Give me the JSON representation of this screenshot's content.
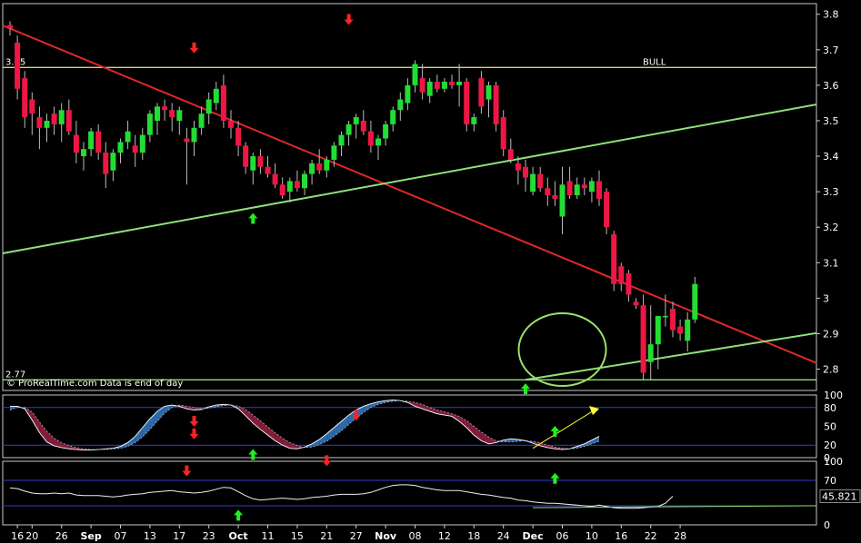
{
  "chart_data": [
    {
      "type": "candlestick",
      "watermark": "© ProRealTime.com  Data is end of day",
      "ylim": [
        2.74,
        3.83
      ],
      "yticks": [
        "3.8",
        "3.7",
        "3.6",
        "3.5",
        "3.4",
        "3.3",
        "3.2",
        "3.1",
        "3",
        "2.9",
        "2.8"
      ],
      "ytick_values": [
        3.8,
        3.7,
        3.6,
        3.5,
        3.4,
        3.3,
        3.2,
        3.1,
        3.0,
        2.9,
        2.8
      ],
      "xticks": [
        {
          "label": "16",
          "i": 1
        },
        {
          "label": "20",
          "i": 3
        },
        {
          "label": "26",
          "i": 7
        },
        {
          "label": "Sep",
          "i": 11,
          "bold": true
        },
        {
          "label": "07",
          "i": 15
        },
        {
          "label": "13",
          "i": 19
        },
        {
          "label": "17",
          "i": 23
        },
        {
          "label": "23",
          "i": 27
        },
        {
          "label": "Oct",
          "i": 31,
          "bold": true
        },
        {
          "label": "11",
          "i": 35
        },
        {
          "label": "15",
          "i": 39
        },
        {
          "label": "21",
          "i": 43
        },
        {
          "label": "27",
          "i": 47
        },
        {
          "label": "Nov",
          "i": 51,
          "bold": true
        },
        {
          "label": "08",
          "i": 55
        },
        {
          "label": "12",
          "i": 59
        },
        {
          "label": "18",
          "i": 63
        },
        {
          "label": "24",
          "i": 67
        },
        {
          "label": "Dec",
          "i": 71,
          "bold": true
        },
        {
          "label": "06",
          "i": 75
        },
        {
          "label": "10",
          "i": 79
        },
        {
          "label": "16",
          "i": 83
        },
        {
          "label": "22",
          "i": 87
        },
        {
          "label": "28",
          "i": 91
        }
      ],
      "levels": [
        {
          "name": "BULL",
          "value": 3.65,
          "label": "3.65",
          "color": "#d6d65a"
        },
        {
          "name": "",
          "value": 2.77,
          "label": "2.77",
          "color": "#9be06b"
        }
      ],
      "candles": [
        [
          3.77,
          3.78,
          3.74,
          3.76
        ],
        [
          3.72,
          3.74,
          3.56,
          3.59
        ],
        [
          3.62,
          3.64,
          3.48,
          3.51
        ],
        [
          3.56,
          3.58,
          3.46,
          3.52
        ],
        [
          3.51,
          3.54,
          3.42,
          3.48
        ],
        [
          3.48,
          3.52,
          3.44,
          3.5
        ],
        [
          3.52,
          3.54,
          3.46,
          3.49
        ],
        [
          3.49,
          3.55,
          3.44,
          3.53
        ],
        [
          3.53,
          3.56,
          3.46,
          3.47
        ],
        [
          3.46,
          3.5,
          3.38,
          3.41
        ],
        [
          3.4,
          3.44,
          3.36,
          3.42
        ],
        [
          3.42,
          3.48,
          3.4,
          3.47
        ],
        [
          3.47,
          3.49,
          3.39,
          3.41
        ],
        [
          3.41,
          3.44,
          3.31,
          3.35
        ],
        [
          3.36,
          3.42,
          3.33,
          3.41
        ],
        [
          3.41,
          3.45,
          3.38,
          3.44
        ],
        [
          3.44,
          3.5,
          3.42,
          3.47
        ],
        [
          3.43,
          3.46,
          3.37,
          3.41
        ],
        [
          3.41,
          3.48,
          3.39,
          3.46
        ],
        [
          3.46,
          3.53,
          3.44,
          3.52
        ],
        [
          3.5,
          3.55,
          3.46,
          3.54
        ],
        [
          3.54,
          3.56,
          3.5,
          3.53
        ],
        [
          3.53,
          3.55,
          3.47,
          3.51
        ],
        [
          3.5,
          3.54,
          3.46,
          3.53
        ],
        [
          3.45,
          3.48,
          3.32,
          3.44
        ],
        [
          3.44,
          3.5,
          3.4,
          3.48
        ],
        [
          3.48,
          3.54,
          3.46,
          3.52
        ],
        [
          3.52,
          3.58,
          3.49,
          3.56
        ],
        [
          3.55,
          3.61,
          3.53,
          3.59
        ],
        [
          3.6,
          3.63,
          3.48,
          3.5
        ],
        [
          3.5,
          3.53,
          3.45,
          3.48
        ],
        [
          3.48,
          3.5,
          3.4,
          3.43
        ],
        [
          3.43,
          3.44,
          3.35,
          3.37
        ],
        [
          3.36,
          3.41,
          3.32,
          3.4
        ],
        [
          3.4,
          3.42,
          3.35,
          3.37
        ],
        [
          3.37,
          3.4,
          3.34,
          3.35
        ],
        [
          3.35,
          3.38,
          3.31,
          3.32
        ],
        [
          3.32,
          3.34,
          3.28,
          3.29
        ],
        [
          3.3,
          3.34,
          3.27,
          3.33
        ],
        [
          3.33,
          3.36,
          3.3,
          3.31
        ],
        [
          3.31,
          3.36,
          3.29,
          3.35
        ],
        [
          3.35,
          3.39,
          3.32,
          3.38
        ],
        [
          3.38,
          3.42,
          3.35,
          3.36
        ],
        [
          3.36,
          3.4,
          3.34,
          3.39
        ],
        [
          3.39,
          3.44,
          3.37,
          3.43
        ],
        [
          3.43,
          3.47,
          3.4,
          3.46
        ],
        [
          3.46,
          3.5,
          3.43,
          3.49
        ],
        [
          3.49,
          3.52,
          3.45,
          3.51
        ],
        [
          3.5,
          3.53,
          3.46,
          3.47
        ],
        [
          3.47,
          3.5,
          3.41,
          3.43
        ],
        [
          3.43,
          3.46,
          3.39,
          3.45
        ],
        [
          3.45,
          3.5,
          3.43,
          3.49
        ],
        [
          3.49,
          3.54,
          3.47,
          3.53
        ],
        [
          3.53,
          3.58,
          3.5,
          3.56
        ],
        [
          3.55,
          3.62,
          3.53,
          3.6
        ],
        [
          3.6,
          3.67,
          3.58,
          3.66
        ],
        [
          3.62,
          3.66,
          3.56,
          3.58
        ],
        [
          3.57,
          3.62,
          3.55,
          3.61
        ],
        [
          3.61,
          3.63,
          3.58,
          3.59
        ],
        [
          3.59,
          3.62,
          3.58,
          3.61
        ],
        [
          3.61,
          3.63,
          3.59,
          3.6
        ],
        [
          3.6,
          3.66,
          3.54,
          3.61
        ],
        [
          3.61,
          3.62,
          3.47,
          3.49
        ],
        [
          3.49,
          3.52,
          3.47,
          3.51
        ],
        [
          3.62,
          3.64,
          3.52,
          3.54
        ],
        [
          3.56,
          3.61,
          3.51,
          3.6
        ],
        [
          3.6,
          3.61,
          3.47,
          3.49
        ],
        [
          3.51,
          3.53,
          3.4,
          3.42
        ],
        [
          3.42,
          3.45,
          3.38,
          3.39
        ],
        [
          3.38,
          3.4,
          3.32,
          3.36
        ],
        [
          3.37,
          3.39,
          3.3,
          3.34
        ],
        [
          3.3,
          3.37,
          3.29,
          3.35
        ],
        [
          3.35,
          3.37,
          3.3,
          3.31
        ],
        [
          3.31,
          3.34,
          3.26,
          3.29
        ],
        [
          3.29,
          3.33,
          3.26,
          3.28
        ],
        [
          3.23,
          3.37,
          3.18,
          3.32
        ],
        [
          3.33,
          3.37,
          3.28,
          3.29
        ],
        [
          3.29,
          3.34,
          3.28,
          3.32
        ],
        [
          3.32,
          3.34,
          3.29,
          3.31
        ],
        [
          3.3,
          3.34,
          3.27,
          3.33
        ],
        [
          3.33,
          3.36,
          3.26,
          3.28
        ],
        [
          3.3,
          3.31,
          3.18,
          3.2
        ],
        [
          3.18,
          3.19,
          3.02,
          3.04
        ],
        [
          3.09,
          3.1,
          3.02,
          3.04
        ],
        [
          3.07,
          3.08,
          2.99,
          3.01
        ],
        [
          2.99,
          3.0,
          2.97,
          2.98
        ],
        [
          2.98,
          3.01,
          2.77,
          2.79
        ],
        [
          2.82,
          2.98,
          2.77,
          2.87
        ],
        [
          2.87,
          2.92,
          2.8,
          2.95
        ],
        [
          2.95,
          3.01,
          2.92,
          2.95
        ],
        [
          2.97,
          2.99,
          2.89,
          2.91
        ],
        [
          2.92,
          2.94,
          2.88,
          2.9
        ],
        [
          2.88,
          2.96,
          2.85,
          2.94
        ],
        [
          2.94,
          3.06,
          2.93,
          3.04
        ]
      ],
      "trendlines": [
        {
          "name": "red-resistance",
          "color": "#e02828",
          "p1": [
            0,
            3.76
          ],
          "p2": [
            79,
            3.08
          ]
        },
        {
          "name": "green-support-upper",
          "color": "#8fe07a",
          "p1": [
            0,
            3.13
          ],
          "p2": [
            79,
            3.43
          ]
        },
        {
          "name": "green-support-lower",
          "color": "#8fe07a",
          "p1": [
            70,
            2.77
          ],
          "p2": [
            79,
            2.8
          ]
        }
      ],
      "arrows": [
        {
          "i": 25,
          "price": 3.7,
          "dir": "down",
          "color": "#ff2222"
        },
        {
          "i": 33,
          "price": 3.23,
          "dir": "up",
          "color": "#22ee22"
        },
        {
          "i": 46,
          "price": 3.78,
          "dir": "down",
          "color": "#ff2222"
        },
        {
          "i": 70,
          "price": 2.75,
          "dir": "up",
          "color": "#22ee22"
        }
      ]
    },
    {
      "type": "stochastic",
      "ylim": [
        0,
        100
      ],
      "ytick_labels": [
        "100",
        "80",
        "50",
        "20",
        "0"
      ],
      "ytick_values": [
        100,
        80,
        50,
        20,
        0
      ],
      "levels": [
        80,
        20
      ],
      "arrows": [
        {
          "i": 25,
          "value": 55,
          "dir": "down",
          "color": "#ff2222"
        },
        {
          "i": 25,
          "value": 35,
          "dir": "down",
          "color": "#ff2222"
        },
        {
          "i": 47,
          "value": 65,
          "dir": "down",
          "color": "#ff2222"
        },
        {
          "i": 33,
          "value": 8,
          "dir": "up",
          "color": "#22ee22"
        },
        {
          "i": 74,
          "value": 45,
          "dir": "up",
          "color": "#22ee22"
        }
      ],
      "k": [
        82,
        82,
        78,
        60,
        40,
        25,
        19,
        16,
        14,
        13,
        12,
        12,
        13,
        14,
        15,
        18,
        24,
        34,
        48,
        62,
        74,
        82,
        84,
        82,
        78,
        76,
        77,
        81,
        84,
        85,
        84,
        78,
        67,
        55,
        45,
        36,
        27,
        20,
        15,
        14,
        17,
        22,
        29,
        38,
        48,
        58,
        68,
        76,
        82,
        86,
        89,
        91,
        92,
        91,
        88,
        82,
        78,
        74,
        70,
        68,
        66,
        58,
        48,
        36,
        27,
        22,
        24,
        28,
        30,
        29,
        27,
        23,
        19,
        16,
        14,
        13,
        14,
        18,
        22,
        28,
        34
      ],
      "d": [
        76,
        80,
        80,
        73,
        57,
        42,
        31,
        24,
        19,
        16,
        14,
        13,
        13,
        13,
        14,
        15,
        18,
        24,
        33,
        45,
        58,
        71,
        80,
        84,
        82,
        80,
        78,
        79,
        81,
        83,
        84,
        82,
        77,
        68,
        59,
        49,
        40,
        31,
        24,
        19,
        16,
        17,
        21,
        26,
        34,
        43,
        53,
        63,
        72,
        80,
        85,
        88,
        90,
        91,
        90,
        88,
        85,
        80,
        76,
        73,
        70,
        66,
        59,
        50,
        41,
        33,
        27,
        25,
        25,
        26,
        27,
        26,
        24,
        20,
        17,
        15,
        14,
        15,
        18,
        22,
        26
      ],
      "arrow_to": {
        "from": [
          71,
          15
        ],
        "to": [
          80,
          78
        ],
        "color": "#ffff33"
      }
    },
    {
      "type": "line",
      "name": "RSI",
      "ylim": [
        0,
        100
      ],
      "ytick_labels": [
        "100",
        "70",
        "50",
        "0"
      ],
      "ytick_values": [
        100,
        70,
        50,
        0
      ],
      "levels": [
        70,
        30
      ],
      "current_label": "45.821",
      "arrows": [
        {
          "i": 24,
          "value": 82,
          "dir": "down",
          "color": "#ff2222"
        },
        {
          "i": 43,
          "value": 98,
          "dir": "down",
          "color": "#ff2222"
        },
        {
          "i": 31,
          "value": 18,
          "dir": "up",
          "color": "#22ee22"
        },
        {
          "i": 74,
          "value": 76,
          "dir": "up",
          "color": "#22ee22"
        }
      ],
      "values": [
        58,
        57,
        53,
        50,
        49,
        49,
        50,
        49,
        50,
        47,
        46,
        46,
        46,
        45,
        44,
        45,
        47,
        48,
        49,
        51,
        52,
        53,
        54,
        52,
        51,
        50,
        51,
        53,
        56,
        59,
        58,
        52,
        46,
        41,
        39,
        40,
        41,
        42,
        41,
        40,
        41,
        43,
        44,
        45,
        47,
        48,
        48,
        48,
        49,
        51,
        55,
        59,
        62,
        63,
        63,
        62,
        59,
        57,
        55,
        54,
        54,
        54,
        52,
        50,
        48,
        47,
        45,
        43,
        42,
        39,
        38,
        36,
        35,
        34,
        34,
        33,
        32,
        31,
        30,
        29,
        31,
        29,
        27,
        26,
        26,
        26,
        27,
        28,
        29,
        34,
        45
      ]
    }
  ]
}
